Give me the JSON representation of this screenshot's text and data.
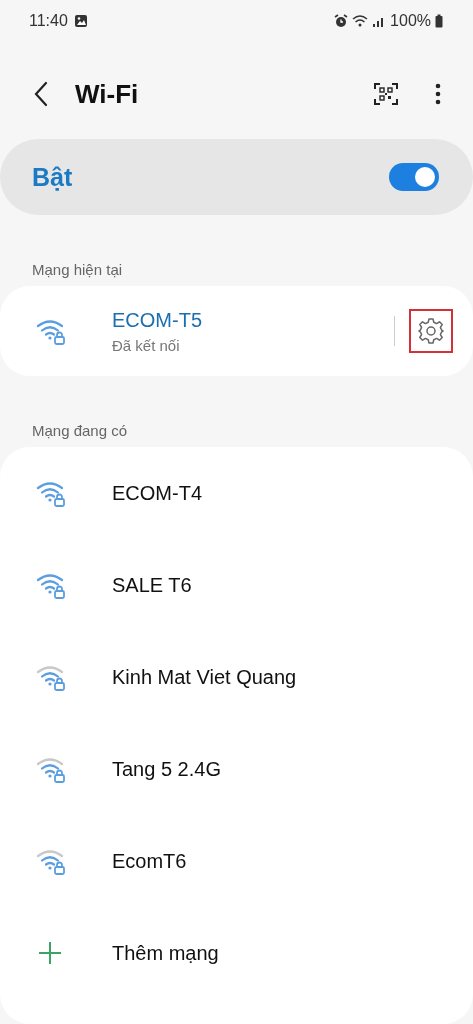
{
  "status_bar": {
    "time": "11:40",
    "battery": "100%"
  },
  "header": {
    "title": "Wi-Fi"
  },
  "master_switch": {
    "label": "Bật",
    "on": true
  },
  "current_section": {
    "title": "Mạng hiện tại",
    "network": {
      "name": "ECOM-T5",
      "status": "Đã kết nối",
      "full_signal": true,
      "settings_highlighted": true
    }
  },
  "available_section": {
    "title": "Mạng đang có",
    "networks": [
      {
        "kind": "network",
        "name": "ECOM-T4",
        "full_signal": true
      },
      {
        "kind": "network",
        "name": "SALE T6",
        "full_signal": true
      },
      {
        "kind": "network",
        "name": "Kinh Mat Viet Quang",
        "full_signal": false
      },
      {
        "kind": "network",
        "name": "Tang 5 2.4G",
        "full_signal": false
      },
      {
        "kind": "network",
        "name": "EcomT6",
        "full_signal": false
      },
      {
        "kind": "add",
        "name": "Thêm mạng"
      }
    ]
  }
}
